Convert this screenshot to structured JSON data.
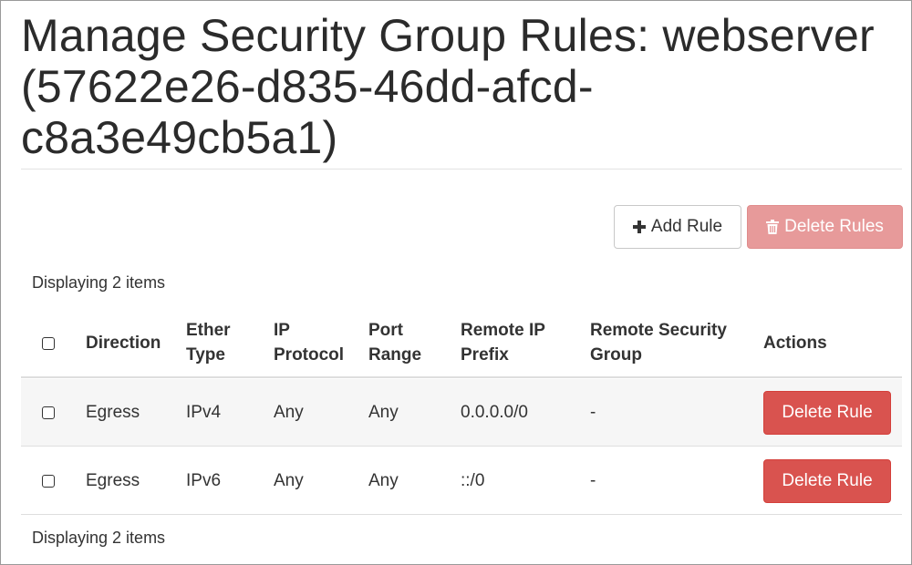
{
  "header": {
    "title": "Manage Security Group Rules: webserver (57622e26-d835-46dd-afcd-c8a3e49cb5a1)"
  },
  "toolbar": {
    "add_rule_label": "Add Rule",
    "delete_rules_label": "Delete Rules",
    "add_icon": "plus-icon",
    "delete_icon": "trash-icon"
  },
  "table": {
    "count_top": "Displaying 2 items",
    "count_bottom": "Displaying 2 items",
    "columns": {
      "direction": "Direction",
      "ether_type": [
        "Ether",
        "Type"
      ],
      "ip_protocol": [
        "IP",
        "Protocol"
      ],
      "port_range": [
        "Port",
        "Range"
      ],
      "remote_ip_prefix": [
        "Remote IP",
        "Prefix"
      ],
      "remote_security_group": [
        "Remote Security",
        "Group"
      ],
      "actions": "Actions"
    },
    "rows": [
      {
        "direction": "Egress",
        "ether_type": "IPv4",
        "ip_protocol": "Any",
        "port_range": "Any",
        "remote_ip_prefix": "0.0.0.0/0",
        "remote_security_group": "-",
        "action_label": "Delete Rule"
      },
      {
        "direction": "Egress",
        "ether_type": "IPv6",
        "ip_protocol": "Any",
        "port_range": "Any",
        "remote_ip_prefix": "::/0",
        "remote_security_group": "-",
        "action_label": "Delete Rule"
      }
    ]
  },
  "colors": {
    "danger": "#d9534f",
    "danger_disabled": "#e79a9a",
    "row_stripe": "#f6f6f6",
    "rule_line": "#dedede"
  }
}
